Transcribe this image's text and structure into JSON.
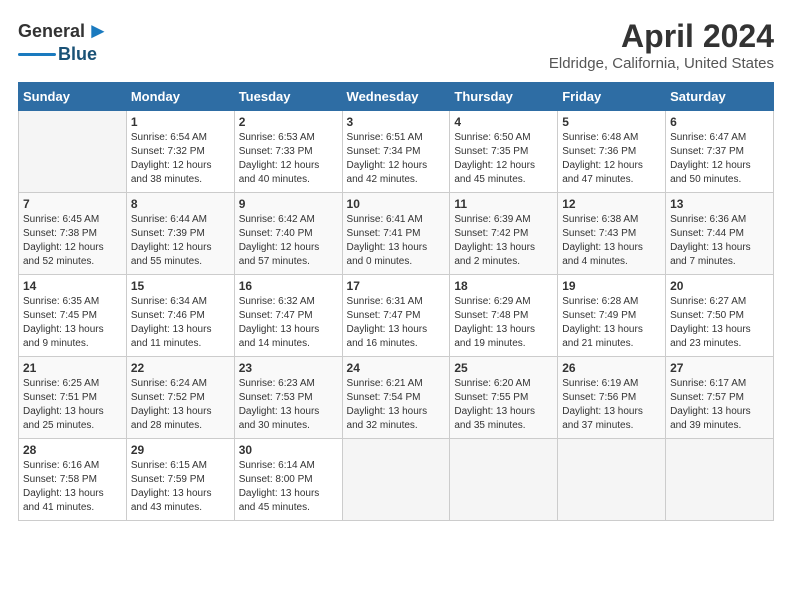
{
  "logo": {
    "general": "General",
    "blue": "Blue",
    "tagline": ""
  },
  "header": {
    "title": "April 2024",
    "location": "Eldridge, California, United States"
  },
  "weekdays": [
    "Sunday",
    "Monday",
    "Tuesday",
    "Wednesday",
    "Thursday",
    "Friday",
    "Saturday"
  ],
  "weeks": [
    [
      {
        "day": "",
        "empty": true
      },
      {
        "day": "1",
        "sunrise": "Sunrise: 6:54 AM",
        "sunset": "Sunset: 7:32 PM",
        "daylight": "Daylight: 12 hours and 38 minutes."
      },
      {
        "day": "2",
        "sunrise": "Sunrise: 6:53 AM",
        "sunset": "Sunset: 7:33 PM",
        "daylight": "Daylight: 12 hours and 40 minutes."
      },
      {
        "day": "3",
        "sunrise": "Sunrise: 6:51 AM",
        "sunset": "Sunset: 7:34 PM",
        "daylight": "Daylight: 12 hours and 42 minutes."
      },
      {
        "day": "4",
        "sunrise": "Sunrise: 6:50 AM",
        "sunset": "Sunset: 7:35 PM",
        "daylight": "Daylight: 12 hours and 45 minutes."
      },
      {
        "day": "5",
        "sunrise": "Sunrise: 6:48 AM",
        "sunset": "Sunset: 7:36 PM",
        "daylight": "Daylight: 12 hours and 47 minutes."
      },
      {
        "day": "6",
        "sunrise": "Sunrise: 6:47 AM",
        "sunset": "Sunset: 7:37 PM",
        "daylight": "Daylight: 12 hours and 50 minutes."
      }
    ],
    [
      {
        "day": "7",
        "sunrise": "Sunrise: 6:45 AM",
        "sunset": "Sunset: 7:38 PM",
        "daylight": "Daylight: 12 hours and 52 minutes."
      },
      {
        "day": "8",
        "sunrise": "Sunrise: 6:44 AM",
        "sunset": "Sunset: 7:39 PM",
        "daylight": "Daylight: 12 hours and 55 minutes."
      },
      {
        "day": "9",
        "sunrise": "Sunrise: 6:42 AM",
        "sunset": "Sunset: 7:40 PM",
        "daylight": "Daylight: 12 hours and 57 minutes."
      },
      {
        "day": "10",
        "sunrise": "Sunrise: 6:41 AM",
        "sunset": "Sunset: 7:41 PM",
        "daylight": "Daylight: 13 hours and 0 minutes."
      },
      {
        "day": "11",
        "sunrise": "Sunrise: 6:39 AM",
        "sunset": "Sunset: 7:42 PM",
        "daylight": "Daylight: 13 hours and 2 minutes."
      },
      {
        "day": "12",
        "sunrise": "Sunrise: 6:38 AM",
        "sunset": "Sunset: 7:43 PM",
        "daylight": "Daylight: 13 hours and 4 minutes."
      },
      {
        "day": "13",
        "sunrise": "Sunrise: 6:36 AM",
        "sunset": "Sunset: 7:44 PM",
        "daylight": "Daylight: 13 hours and 7 minutes."
      }
    ],
    [
      {
        "day": "14",
        "sunrise": "Sunrise: 6:35 AM",
        "sunset": "Sunset: 7:45 PM",
        "daylight": "Daylight: 13 hours and 9 minutes."
      },
      {
        "day": "15",
        "sunrise": "Sunrise: 6:34 AM",
        "sunset": "Sunset: 7:46 PM",
        "daylight": "Daylight: 13 hours and 11 minutes."
      },
      {
        "day": "16",
        "sunrise": "Sunrise: 6:32 AM",
        "sunset": "Sunset: 7:47 PM",
        "daylight": "Daylight: 13 hours and 14 minutes."
      },
      {
        "day": "17",
        "sunrise": "Sunrise: 6:31 AM",
        "sunset": "Sunset: 7:47 PM",
        "daylight": "Daylight: 13 hours and 16 minutes."
      },
      {
        "day": "18",
        "sunrise": "Sunrise: 6:29 AM",
        "sunset": "Sunset: 7:48 PM",
        "daylight": "Daylight: 13 hours and 19 minutes."
      },
      {
        "day": "19",
        "sunrise": "Sunrise: 6:28 AM",
        "sunset": "Sunset: 7:49 PM",
        "daylight": "Daylight: 13 hours and 21 minutes."
      },
      {
        "day": "20",
        "sunrise": "Sunrise: 6:27 AM",
        "sunset": "Sunset: 7:50 PM",
        "daylight": "Daylight: 13 hours and 23 minutes."
      }
    ],
    [
      {
        "day": "21",
        "sunrise": "Sunrise: 6:25 AM",
        "sunset": "Sunset: 7:51 PM",
        "daylight": "Daylight: 13 hours and 25 minutes."
      },
      {
        "day": "22",
        "sunrise": "Sunrise: 6:24 AM",
        "sunset": "Sunset: 7:52 PM",
        "daylight": "Daylight: 13 hours and 28 minutes."
      },
      {
        "day": "23",
        "sunrise": "Sunrise: 6:23 AM",
        "sunset": "Sunset: 7:53 PM",
        "daylight": "Daylight: 13 hours and 30 minutes."
      },
      {
        "day": "24",
        "sunrise": "Sunrise: 6:21 AM",
        "sunset": "Sunset: 7:54 PM",
        "daylight": "Daylight: 13 hours and 32 minutes."
      },
      {
        "day": "25",
        "sunrise": "Sunrise: 6:20 AM",
        "sunset": "Sunset: 7:55 PM",
        "daylight": "Daylight: 13 hours and 35 minutes."
      },
      {
        "day": "26",
        "sunrise": "Sunrise: 6:19 AM",
        "sunset": "Sunset: 7:56 PM",
        "daylight": "Daylight: 13 hours and 37 minutes."
      },
      {
        "day": "27",
        "sunrise": "Sunrise: 6:17 AM",
        "sunset": "Sunset: 7:57 PM",
        "daylight": "Daylight: 13 hours and 39 minutes."
      }
    ],
    [
      {
        "day": "28",
        "sunrise": "Sunrise: 6:16 AM",
        "sunset": "Sunset: 7:58 PM",
        "daylight": "Daylight: 13 hours and 41 minutes."
      },
      {
        "day": "29",
        "sunrise": "Sunrise: 6:15 AM",
        "sunset": "Sunset: 7:59 PM",
        "daylight": "Daylight: 13 hours and 43 minutes."
      },
      {
        "day": "30",
        "sunrise": "Sunrise: 6:14 AM",
        "sunset": "Sunset: 8:00 PM",
        "daylight": "Daylight: 13 hours and 45 minutes."
      },
      {
        "day": "",
        "empty": true
      },
      {
        "day": "",
        "empty": true
      },
      {
        "day": "",
        "empty": true
      },
      {
        "day": "",
        "empty": true
      }
    ]
  ]
}
